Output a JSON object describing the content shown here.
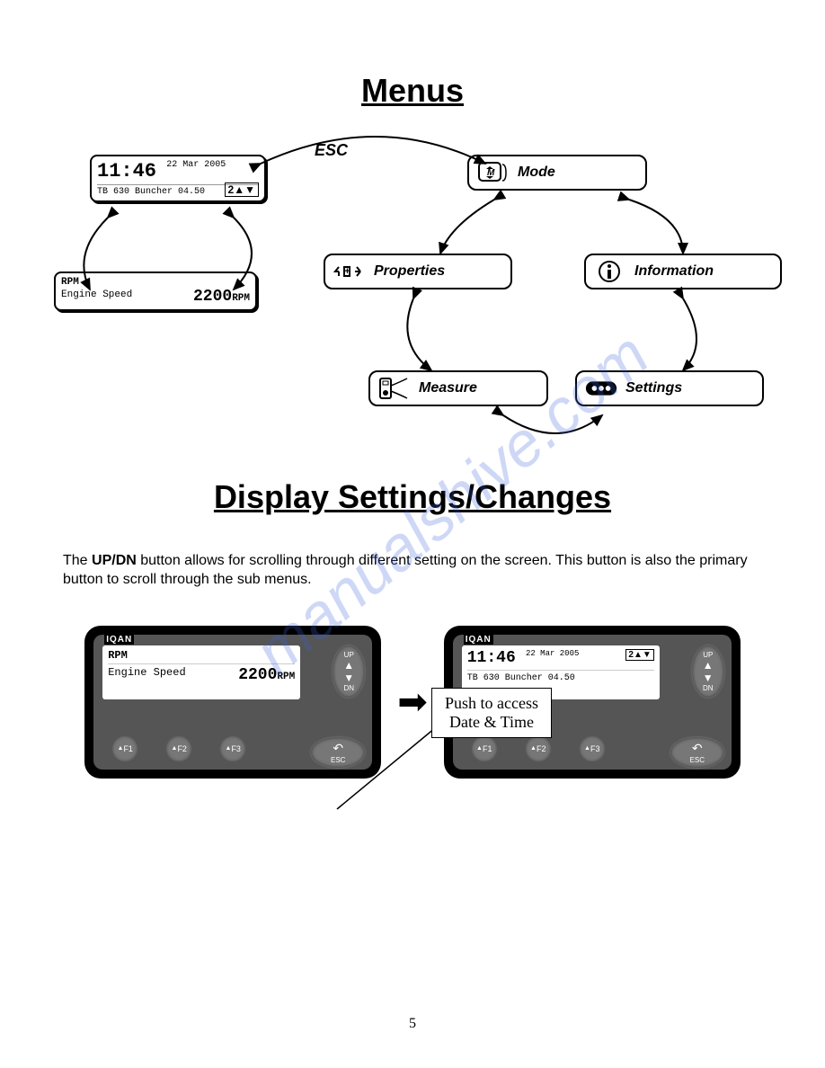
{
  "watermark": "manualshive.com",
  "title1": "Menus",
  "title2": "Display Settings/Changes",
  "esc_label": "ESC",
  "menu": {
    "mode": "Mode",
    "properties": "Properties",
    "information": "Information",
    "measure": "Measure",
    "settings": "Settings"
  },
  "lcd_home": {
    "time": "11:46",
    "date": "22 Mar 2005",
    "indicator": "2",
    "line2": "TB 630 Buncher 04.50"
  },
  "lcd_rpm": {
    "label": "RPM",
    "row_label": "Engine Speed",
    "value": "2200",
    "unit": "RPM"
  },
  "body_para": {
    "pre": "The ",
    "bold": "UP/DN",
    "post": " button allows for scrolling through different setting on the screen.  This button is also the primary button to scroll through the sub menus."
  },
  "callout": {
    "line1": "Push to access",
    "line2": "Date & Time"
  },
  "device": {
    "brand": "IQAN",
    "up_label": "UP",
    "dn_label": "DN",
    "f1": "F1",
    "f2": "F2",
    "f3": "F3",
    "esc": "ESC"
  },
  "page_number": "5"
}
